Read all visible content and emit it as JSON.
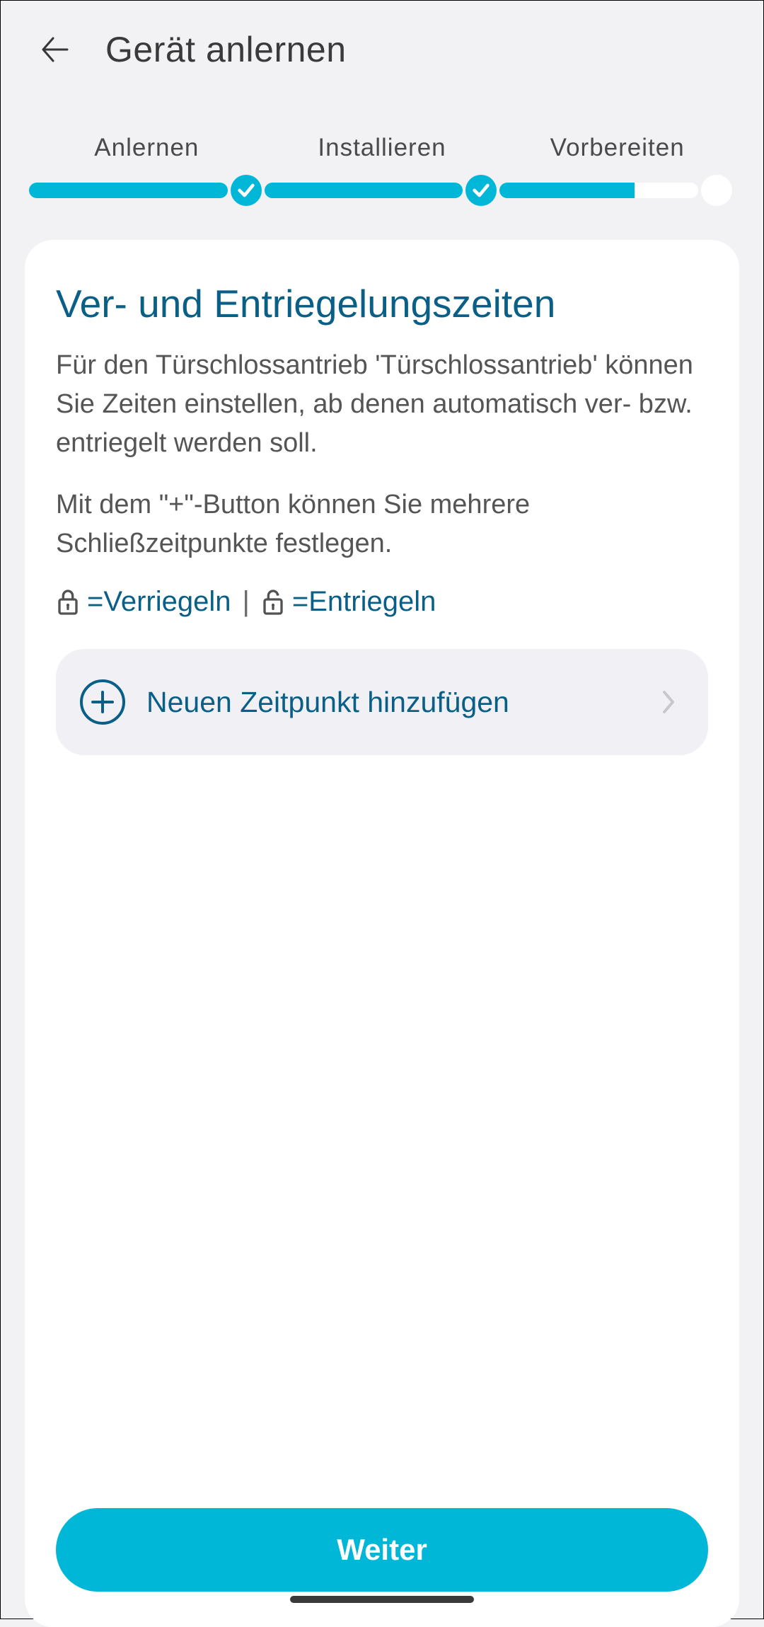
{
  "header": {
    "title": "Gerät anlernen"
  },
  "progress": {
    "steps": [
      "Anlernen",
      "Installieren",
      "Vorbereiten"
    ],
    "completed": [
      true,
      true,
      false
    ],
    "current_partial": 0.68
  },
  "card": {
    "title": "Ver- und Entriegelungszeiten",
    "para1": "Für den Türschlossantrieb 'Türschlossantrieb' können Sie Zeiten einstellen, ab denen automatisch ver- bzw. entriegelt werden soll.",
    "para2": "Mit dem \"+\"-Button können Sie mehrere Schließzeitpunkte festlegen.",
    "legend_lock": "=Verriegeln",
    "legend_sep": " | ",
    "legend_unlock": "=Entriegeln",
    "add_label": "Neuen Zeitpunkt hinzufügen",
    "cta": "Weiter"
  }
}
